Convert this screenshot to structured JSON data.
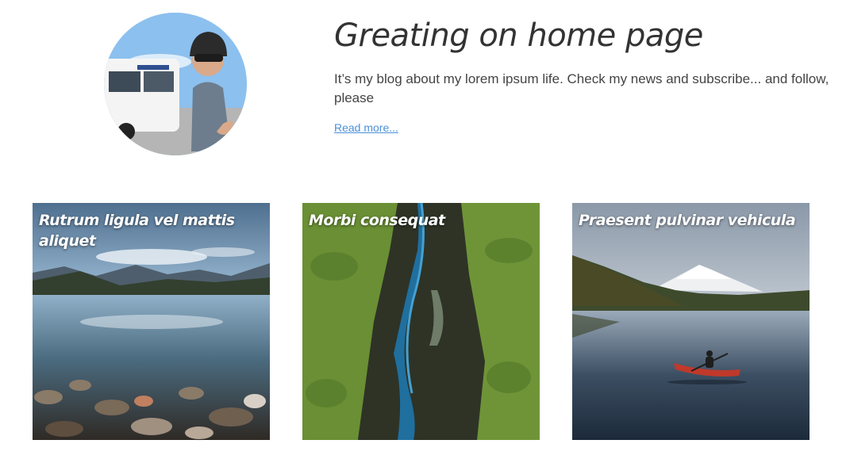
{
  "hero": {
    "title": "Greating on home page",
    "text": "It’s my blog about my lorem ipsum life. Check my news and subscribe... and follow, please",
    "read_more": "Read more..."
  },
  "cards": [
    {
      "title": "Rutrum ligula vel mattis aliquet"
    },
    {
      "title": "Morbi consequat"
    },
    {
      "title": "Praesent pulvinar vehicula"
    }
  ],
  "colors": {
    "link": "#4a90d9",
    "text": "#444444",
    "card_title": "#ffffff"
  }
}
